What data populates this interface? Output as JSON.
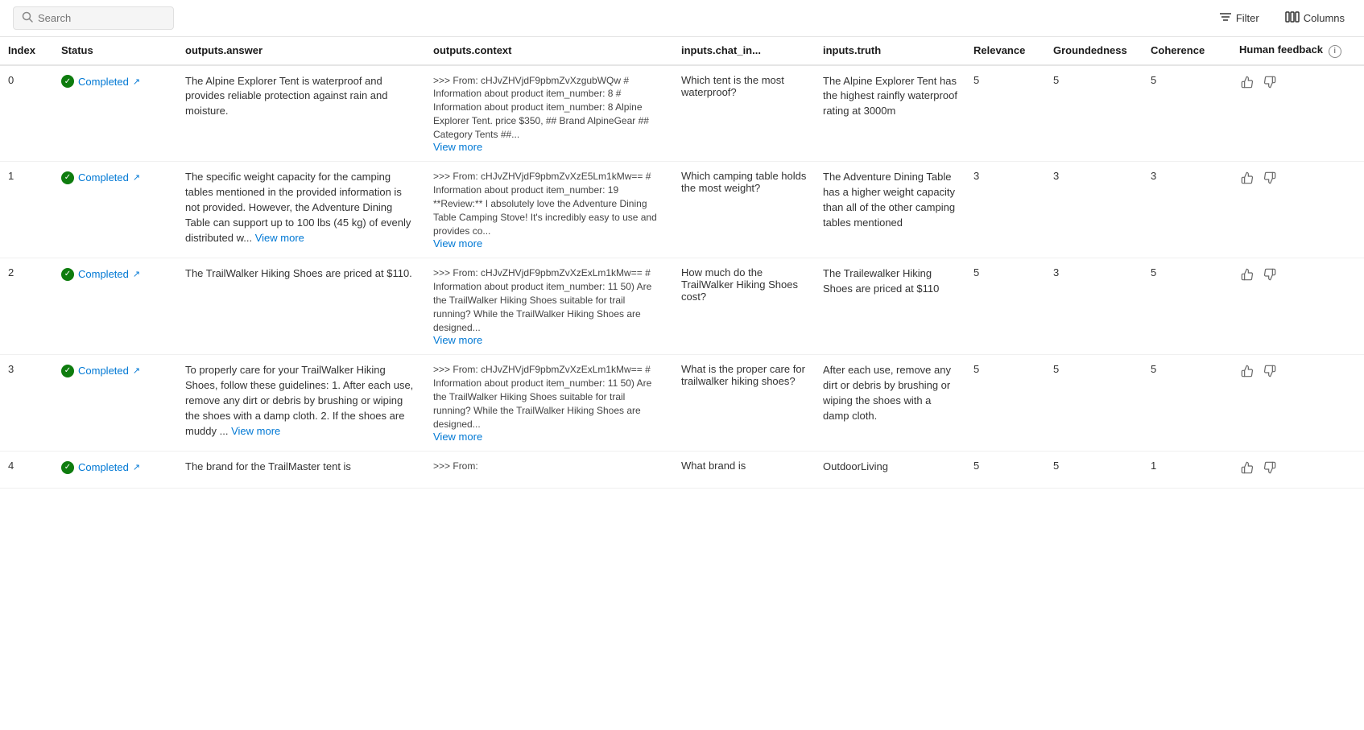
{
  "toolbar": {
    "search_placeholder": "Search",
    "filter_label": "Filter",
    "columns_label": "Columns"
  },
  "table": {
    "columns": [
      {
        "id": "index",
        "label": "Index"
      },
      {
        "id": "status",
        "label": "Status"
      },
      {
        "id": "answer",
        "label": "outputs.answer"
      },
      {
        "id": "context",
        "label": "outputs.context"
      },
      {
        "id": "chat_in",
        "label": "inputs.chat_in..."
      },
      {
        "id": "truth",
        "label": "inputs.truth"
      },
      {
        "id": "relevance",
        "label": "Relevance"
      },
      {
        "id": "groundedness",
        "label": "Groundedness"
      },
      {
        "id": "coherence",
        "label": "Coherence"
      },
      {
        "id": "feedback",
        "label": "Human feedback"
      }
    ],
    "rows": [
      {
        "index": "0",
        "status": "Completed",
        "answer": "The Alpine Explorer Tent is waterproof and provides reliable protection against rain and moisture.",
        "context": ">>> From: cHJvZHVjdF9pbmZvXzgubWQw # Information about product item_number: 8 # Information about product item_number: 8 Alpine Explorer Tent. price $350, ## Brand AlpineGear ## Category Tents ##...",
        "context_has_viewmore": true,
        "chat_in": "Which tent is the most waterproof?",
        "truth": "The Alpine Explorer Tent has the highest rainfly waterproof rating at 3000m",
        "relevance": "5",
        "groundedness": "5",
        "coherence": "5"
      },
      {
        "index": "1",
        "status": "Completed",
        "answer": "The specific weight capacity for the camping tables mentioned in the provided information is not provided. However, the Adventure Dining Table can support up to 100 lbs (45 kg) of evenly distributed w...",
        "answer_has_viewmore": true,
        "answer_viewmore": "View more",
        "context": ">>> From: cHJvZHVjdF9pbmZvXzE5Lm1kMw== # Information about product item_number: 19 **Review:** I absolutely love the Adventure Dining Table Camping Stove! It's incredibly easy to use and provides co...",
        "context_has_viewmore": true,
        "chat_in": "Which camping table holds the most weight?",
        "truth": "The Adventure Dining Table has a higher weight capacity than all of the other camping tables mentioned",
        "relevance": "3",
        "groundedness": "3",
        "coherence": "3"
      },
      {
        "index": "2",
        "status": "Completed",
        "answer": "The TrailWalker Hiking Shoes are priced at $110.",
        "context": ">>> From: cHJvZHVjdF9pbmZvXzExLm1kMw== # Information about product item_number: 11 50) Are the TrailWalker Hiking Shoes suitable for trail running? While the TrailWalker Hiking Shoes are designed...",
        "context_has_viewmore": true,
        "chat_in": "How much do the TrailWalker Hiking Shoes cost?",
        "truth": "The Trailewalker Hiking Shoes are priced at $110",
        "relevance": "5",
        "groundedness": "3",
        "coherence": "5"
      },
      {
        "index": "3",
        "status": "Completed",
        "answer": "To properly care for your TrailWalker Hiking Shoes, follow these guidelines: 1. After each use, remove any dirt or debris by brushing or wiping the shoes with a damp cloth. 2. If the shoes are muddy ...",
        "answer_has_viewmore": true,
        "answer_viewmore": "View more",
        "context": ">>> From: cHJvZHVjdF9pbmZvXzExLm1kMw== # Information about product item_number: 11 50) Are the TrailWalker Hiking Shoes suitable for trail running? While the TrailWalker Hiking Shoes are designed...",
        "context_has_viewmore": true,
        "chat_in": "What is the proper care for trailwalker hiking shoes?",
        "truth": "After each use, remove any dirt or debris by brushing or wiping the shoes with a damp cloth.",
        "relevance": "5",
        "groundedness": "5",
        "coherence": "5"
      },
      {
        "index": "4",
        "status": "Completed",
        "answer": "The brand for the TrailMaster tent is",
        "context": ">>> From:",
        "context_has_viewmore": false,
        "chat_in": "What brand is",
        "truth": "OutdoorLiving",
        "relevance": "5",
        "groundedness": "5",
        "coherence": "1"
      }
    ]
  }
}
